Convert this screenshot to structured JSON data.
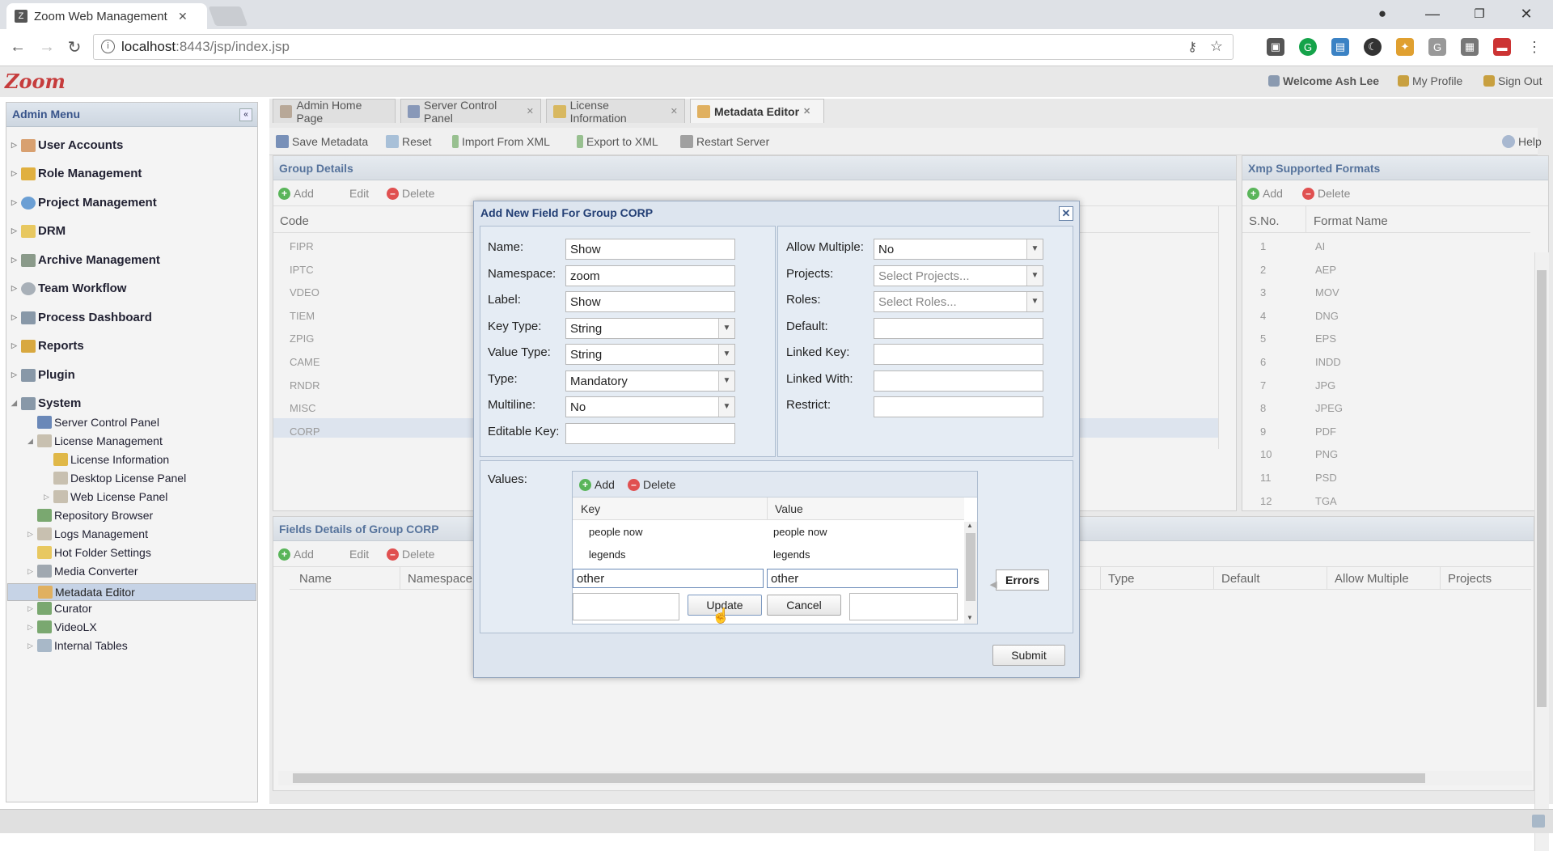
{
  "browser": {
    "tab_title": "Zoom Web Management",
    "url_host": "localhost",
    "url_rest": ":8443/jsp/index.jsp"
  },
  "header": {
    "logo": "Zoom",
    "welcome": "Welcome Ash Lee",
    "my_profile": "My Profile",
    "sign_out": "Sign Out"
  },
  "sidebar": {
    "title": "Admin Menu",
    "items": [
      {
        "label": "User Accounts"
      },
      {
        "label": "Role Management"
      },
      {
        "label": "Project Management"
      },
      {
        "label": "DRM"
      },
      {
        "label": "Archive Management"
      },
      {
        "label": "Team Workflow"
      },
      {
        "label": "Process Dashboard"
      },
      {
        "label": "Reports"
      },
      {
        "label": "Plugin"
      },
      {
        "label": "System"
      }
    ],
    "system_children": [
      {
        "label": "Server Control Panel"
      },
      {
        "label": "License Management"
      },
      {
        "label": "License Information"
      },
      {
        "label": "Desktop License Panel"
      },
      {
        "label": "Web License Panel"
      },
      {
        "label": "Repository Browser"
      },
      {
        "label": "Logs Management"
      },
      {
        "label": "Hot Folder Settings"
      },
      {
        "label": "Media Converter"
      },
      {
        "label": "Metadata Editor"
      },
      {
        "label": "Curator"
      },
      {
        "label": "VideoLX"
      },
      {
        "label": "Internal Tables"
      }
    ]
  },
  "tabs": [
    {
      "label": "Admin Home Page"
    },
    {
      "label": "Server Control Panel"
    },
    {
      "label": "License Information"
    },
    {
      "label": "Metadata Editor"
    }
  ],
  "toolbar": {
    "save": "Save Metadata",
    "reset": "Reset",
    "import": "Import From XML",
    "export": "Export to XML",
    "restart": "Restart Server",
    "help": "Help"
  },
  "group_details": {
    "title": "Group Details",
    "add": "Add",
    "edit": "Edit",
    "delete": "Delete",
    "col_code": "Code",
    "codes": [
      "FIPR",
      "IPTC",
      "VDEO",
      "TIEM",
      "ZPIG",
      "CAME",
      "RNDR",
      "MISC",
      "CORP"
    ]
  },
  "xmp": {
    "title": "Xmp Supported Formats",
    "add": "Add",
    "delete": "Delete",
    "col_sno": "S.No.",
    "col_format": "Format Name",
    "rows": [
      {
        "sno": "1",
        "name": "AI"
      },
      {
        "sno": "2",
        "name": "AEP"
      },
      {
        "sno": "3",
        "name": "MOV"
      },
      {
        "sno": "4",
        "name": "DNG"
      },
      {
        "sno": "5",
        "name": "EPS"
      },
      {
        "sno": "6",
        "name": "INDD"
      },
      {
        "sno": "7",
        "name": "JPG"
      },
      {
        "sno": "8",
        "name": "JPEG"
      },
      {
        "sno": "9",
        "name": "PDF"
      },
      {
        "sno": "10",
        "name": "PNG"
      },
      {
        "sno": "11",
        "name": "PSD"
      },
      {
        "sno": "12",
        "name": "TGA"
      }
    ]
  },
  "fields": {
    "title": "Fields Details of Group CORP",
    "add": "Add",
    "edit": "Edit",
    "delete": "Delete",
    "cols": [
      "Name",
      "Namespace",
      "Type",
      "Default",
      "Allow Multiple",
      "Projects"
    ]
  },
  "dialog": {
    "title": "Add New Field For Group CORP",
    "name_label": "Name:",
    "name_value": "Show",
    "namespace_label": "Namespace:",
    "namespace_value": "zoom",
    "label_label": "Label:",
    "label_value": "Show",
    "keytype_label": "Key Type:",
    "keytype_value": "String",
    "valuetype_label": "Value Type:",
    "valuetype_value": "String",
    "type_label": "Type:",
    "type_value": "Mandatory",
    "multiline_label": "Multiline:",
    "multiline_value": "No",
    "editablekey_label": "Editable Key:",
    "allowmultiple_label": "Allow Multiple:",
    "allowmultiple_value": "No",
    "projects_label": "Projects:",
    "projects_placeholder": "Select Projects...",
    "roles_label": "Roles:",
    "roles_placeholder": "Select Roles...",
    "default_label": "Default:",
    "linkedkey_label": "Linked Key:",
    "linkedwith_label": "Linked With:",
    "restrict_label": "Restrict:",
    "values_label": "Values:",
    "values_add": "Add",
    "values_delete": "Delete",
    "col_key": "Key",
    "col_value": "Value",
    "rows": [
      {
        "key": "people now",
        "value": "people now"
      },
      {
        "key": "legends",
        "value": "legends"
      }
    ],
    "edit_key": "other",
    "edit_value": "other",
    "update": "Update",
    "cancel": "Cancel",
    "errors": "Errors",
    "submit": "Submit"
  }
}
